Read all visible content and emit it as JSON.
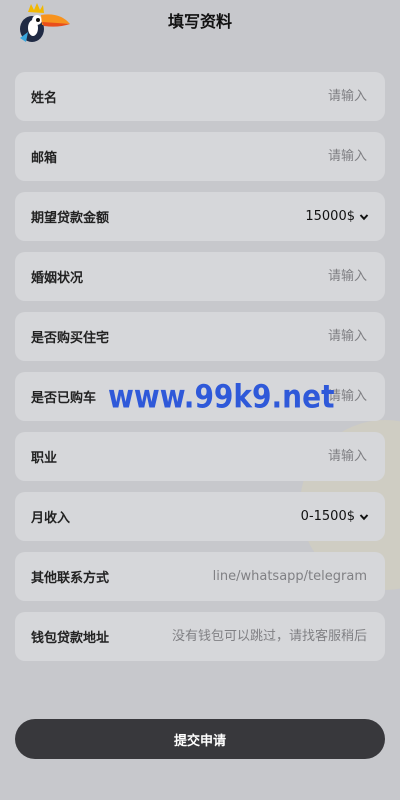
{
  "header": {
    "title": "填写资料"
  },
  "form": {
    "fields": [
      {
        "label": "姓名",
        "placeholder": "请输入"
      },
      {
        "label": "邮箱",
        "placeholder": "请输入"
      },
      {
        "label": "期望贷款金额",
        "value": "15000$"
      },
      {
        "label": "婚姻状况",
        "placeholder": "请输入"
      },
      {
        "label": "是否购买住宅",
        "placeholder": "请输入"
      },
      {
        "label": "是否已购车",
        "placeholder": "请输入"
      },
      {
        "label": "职业",
        "placeholder": "请输入"
      },
      {
        "label": "月收入",
        "value": "0-1500$"
      },
      {
        "label": "其他联系方式",
        "placeholder": "line/whatsapp/telegram"
      },
      {
        "label": "钱包贷款地址",
        "placeholder": "没有钱包可以跳过，请找客服稍后"
      }
    ]
  },
  "watermark": "www.99k9.net",
  "submit_label": "提交申请",
  "icons": {
    "logo": "toucan-crown-logo-icon",
    "dropdown": "chevron-down-icon"
  },
  "colors": {
    "background": "#c7c8cc",
    "field_bg": "#d6d7da",
    "submit_bg": "#38383c",
    "watermark": "#2f59d9"
  }
}
